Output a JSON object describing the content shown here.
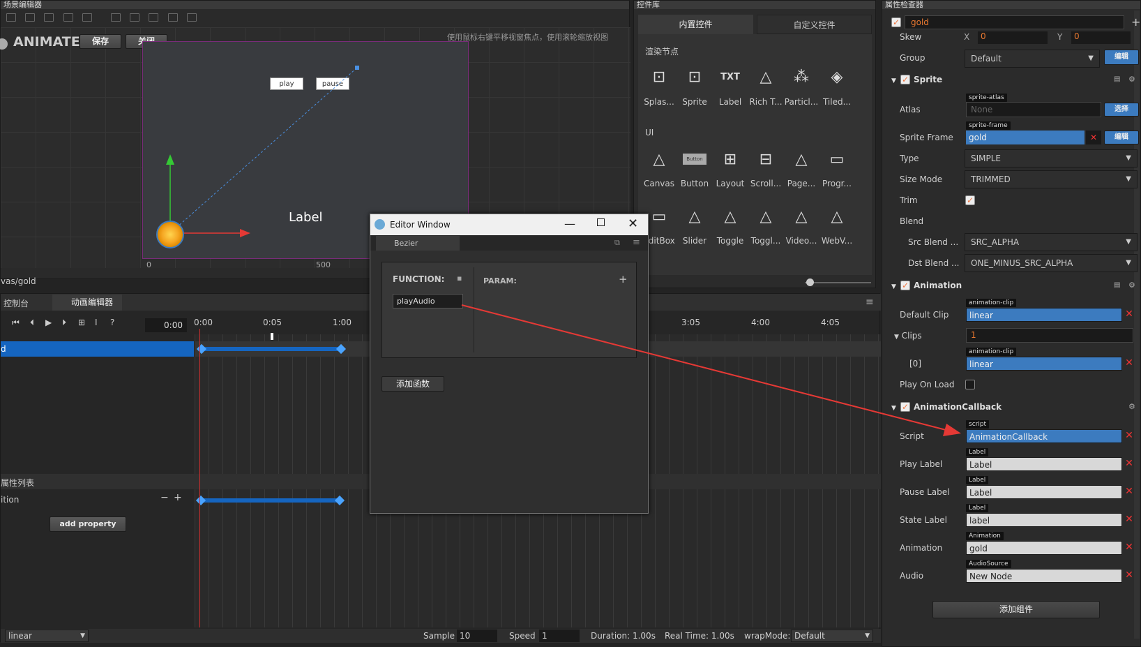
{
  "scene": {
    "title": "场景编辑器",
    "app_label": "ANIMATE",
    "save_label": "保存",
    "close_label": "关闭",
    "hint": "使用鼠标右键平移视窗焦点，使用滚轮缩放视图",
    "play_label": "play",
    "pause_label": "pause",
    "label_text": "Label",
    "ruler_0": "0",
    "ruler_500": "500",
    "path": "vas/gold"
  },
  "widgets": {
    "title": "控件库",
    "tab_builtin": "内置控件",
    "tab_custom": "自定义控件",
    "section_render": "渲染节点",
    "section_ui": "UI",
    "render_items": [
      "Splas...",
      "Sprite",
      "Label",
      "Rich T...",
      "Particl...",
      "Tiled..."
    ],
    "ui_items_row1": [
      "Canvas",
      "Button",
      "Layout",
      "Scroll...",
      "Page...",
      "Progr..."
    ],
    "ui_items_row2": [
      "EditBox",
      "Slider",
      "Toggle",
      "Toggl...",
      "Video...",
      "WebV..."
    ],
    "txt_icon": "TXT",
    "button_icon": "Button"
  },
  "timeline": {
    "tab_console": "控制台",
    "tab_anim": "动画编辑器",
    "time_value": "0:00",
    "ticks": [
      "0:00",
      "0:05",
      "1:00",
      "3:05",
      "4:00",
      "4:05"
    ],
    "props_title": "属性列表",
    "prop_row": "ition",
    "add_property": "add property",
    "clip_value": "linear",
    "sample_label": "Sample",
    "sample_value": "10",
    "speed_label": "Speed",
    "speed_value": "1",
    "duration": "Duration: 1.00s",
    "real_time": "Real Time: 1.00s",
    "wrapmode_label": "wrapMode:",
    "wrapmode_value": "Default",
    "node_row": "d"
  },
  "editor_window": {
    "title": "Editor Window",
    "tab": "Bezier",
    "function_label": "FUNCTION:",
    "param_label": "PARAM:",
    "function_value": "playAudio",
    "add_function": "添加函数"
  },
  "inspector": {
    "title": "属性检查器",
    "node_name": "gold",
    "skew_label": "Skew",
    "skew_x": "0",
    "skew_y": "0",
    "x_axis": "X",
    "y_axis": "Y",
    "group_label": "Group",
    "group_value": "Default",
    "edit_label": "编辑",
    "select_label": "选择",
    "sprite_section": "Sprite",
    "atlas_label": "Atlas",
    "atlas_tag": "sprite-atlas",
    "atlas_value": "None",
    "frame_label": "Sprite Frame",
    "frame_tag": "sprite-frame",
    "frame_value": "gold",
    "type_label": "Type",
    "type_value": "SIMPLE",
    "size_mode_label": "Size Mode",
    "size_mode_value": "TRIMMED",
    "trim_label": "Trim",
    "blend_label": "Blend",
    "src_blend_label": "Src Blend ...",
    "src_blend_value": "SRC_ALPHA",
    "dst_blend_label": "Dst Blend ...",
    "dst_blend_value": "ONE_MINUS_SRC_ALPHA",
    "animation_section": "Animation",
    "default_clip_label": "Default Clip",
    "clip_tag": "animation-clip",
    "default_clip_value": "linear",
    "clips_label": "Clips",
    "clips_count": "1",
    "clip0_label": "[0]",
    "clip0_value": "linear",
    "play_on_load_label": "Play On Load",
    "callback_section": "AnimationCallback",
    "script_label": "Script",
    "script_tag": "script",
    "script_value": "AnimationCallback",
    "play_label_label": "Play Label",
    "label_tag": "Label",
    "play_label_value": "Label",
    "pause_label_label": "Pause Label",
    "pause_label_value": "Label",
    "state_label_label": "State Label",
    "state_label_value": "label",
    "animation_label": "Animation",
    "animation_tag": "Animation",
    "animation_value": "gold",
    "audio_label": "Audio",
    "audio_tag": "AudioSource",
    "audio_value": "New Node",
    "add_component": "添加组件"
  },
  "colors": {
    "accent_blue": "#3c7bbf",
    "timeline_selected": "#1565c0",
    "arrow_red": "#e53935",
    "remove_red": "#e33333"
  }
}
